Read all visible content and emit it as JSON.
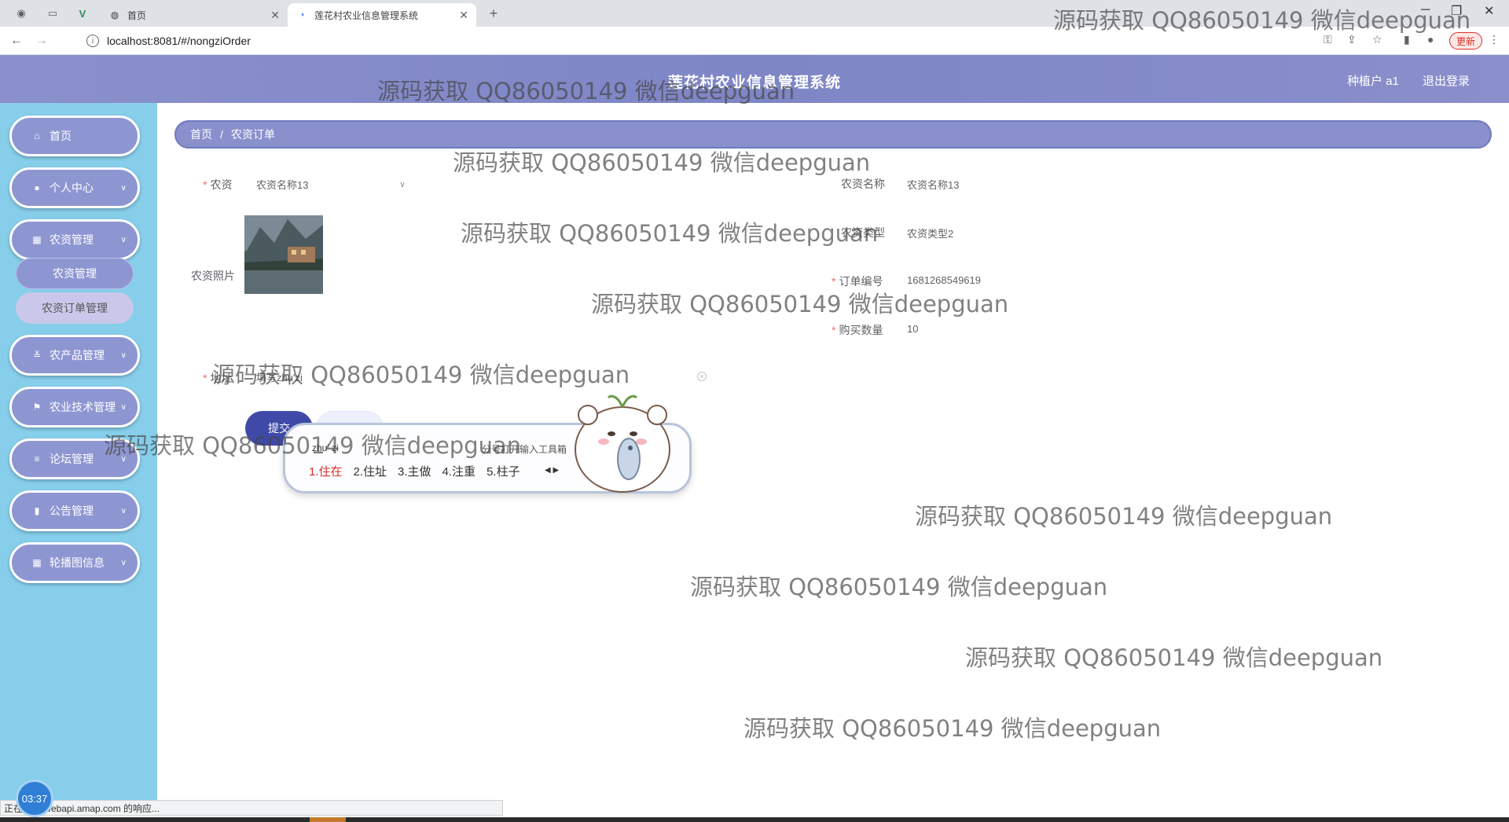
{
  "browser": {
    "inactive_tab_title": "首页",
    "active_tab_title": "莲花村农业信息管理系统",
    "url": "localhost:8081/#/nongziOrder",
    "update_label": "更新"
  },
  "header": {
    "title": "莲花村农业信息管理系统",
    "user": "种植户 a1",
    "logout": "退出登录"
  },
  "sidebar": {
    "items": [
      {
        "label": "首页",
        "icon": "home-icon"
      },
      {
        "label": "个人中心",
        "icon": "user-icon"
      },
      {
        "label": "农资管理",
        "icon": "grid-icon"
      },
      {
        "label": "农产品管理",
        "icon": "sliders-icon"
      },
      {
        "label": "农业技术管理",
        "icon": "flag-icon"
      },
      {
        "label": "论坛管理",
        "icon": "list-icon"
      },
      {
        "label": "公告管理",
        "icon": "bar-chart-icon"
      },
      {
        "label": "轮播图信息",
        "icon": "grid-icon"
      }
    ],
    "submenu": [
      "农资管理",
      "农资订单管理"
    ]
  },
  "breadcrumb": {
    "home": "首页",
    "sep": "/",
    "current": "农资订单"
  },
  "form": {
    "nongzi_label": "农资",
    "nongzi_value": "农资名称13",
    "photo_label": "农资照片",
    "address_label": "地址",
    "address_value": "填写zhu'zi",
    "name_label": "农资名称",
    "name_value": "农资名称13",
    "type_label": "农资类型",
    "type_value": "农资类型2",
    "order_label": "订单编号",
    "order_value": "1681268549619",
    "qty_label": "购买数量",
    "qty_value": "10",
    "submit_label": "提交"
  },
  "ime": {
    "pinyin": "zhu' zi",
    "hint": "分号打开输入工具箱",
    "candidates": [
      "1.住在",
      "2.住址",
      "3.主做",
      "4.注重",
      "5.柱子"
    ]
  },
  "watermark": "源码获取 QQ86050149 微信deepguan",
  "status": {
    "loading_text": "正在等待 webapi.amap.com 的响应...",
    "clock": "03:37"
  }
}
